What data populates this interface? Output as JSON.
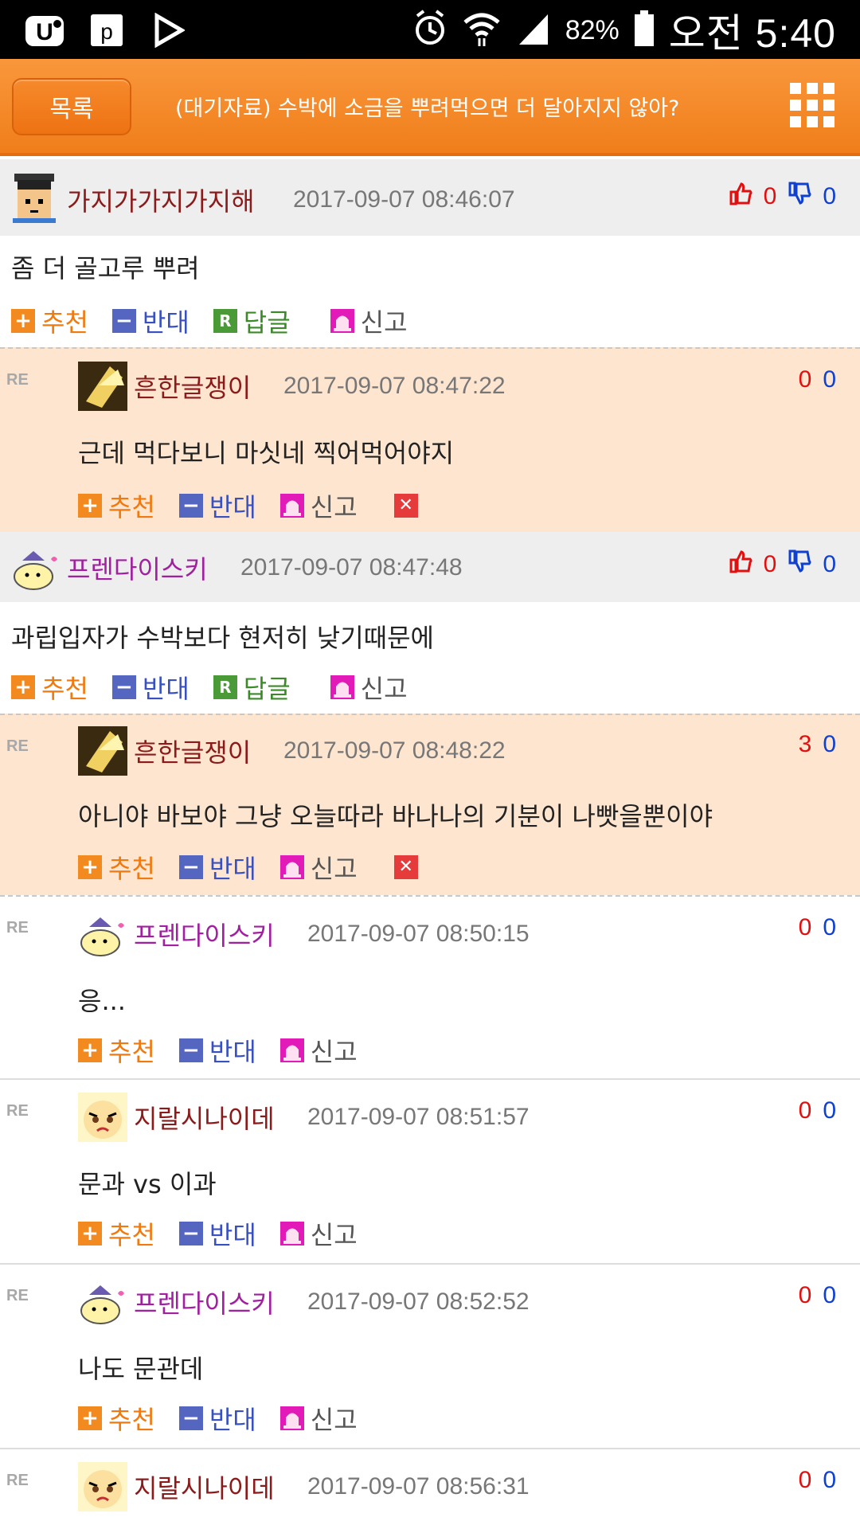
{
  "status_bar": {
    "battery": "82%",
    "time": "오전 5:40"
  },
  "header": {
    "list_button": "목록",
    "title": "(대기자료) 수박에 소금을 뿌려먹으면 더 달아지지 않아?"
  },
  "actions": {
    "recommend": "추천",
    "oppose": "반대",
    "reply": "답글",
    "report": "신고",
    "re_marker": "RE",
    "reply_box": "R"
  },
  "comments": [
    {
      "nick": "가지가가지가지해",
      "date": "2017-09-07 08:46:07",
      "text": "좀 더 골고루 뿌려",
      "up": "0",
      "down": "0",
      "nick_color": "#8b1a1a"
    },
    {
      "nick": "흔한글쟁이",
      "date": "2017-09-07 08:47:22",
      "text": "근데 먹다보니 마싯네 찍어먹어야지",
      "up": "0",
      "down": "0",
      "nick_color": "#8b1a1a"
    },
    {
      "nick": "프렌다이스키",
      "date": "2017-09-07 08:47:48",
      "text": "과립입자가 수박보다 현저히 낮기때문에",
      "up": "0",
      "down": "0",
      "nick_color": "#a020a0"
    },
    {
      "nick": "흔한글쟁이",
      "date": "2017-09-07 08:48:22",
      "text": "아니야 바보야 그냥 오늘따라 바나나의 기분이 나빳을뿐이야",
      "up": "3",
      "down": "0",
      "nick_color": "#8b1a1a"
    },
    {
      "nick": "프렌다이스키",
      "date": "2017-09-07 08:50:15",
      "text": "응...",
      "up": "0",
      "down": "0",
      "nick_color": "#a020a0"
    },
    {
      "nick": "지랄시나이데",
      "date": "2017-09-07 08:51:57",
      "text": "문과 vs 이과",
      "up": "0",
      "down": "0",
      "nick_color": "#8b1a1a"
    },
    {
      "nick": "프렌다이스키",
      "date": "2017-09-07 08:52:52",
      "text": "나도 문관데",
      "up": "0",
      "down": "0",
      "nick_color": "#a020a0"
    },
    {
      "nick": "지랄시나이데",
      "date": "2017-09-07 08:56:31",
      "text": "",
      "up": "0",
      "down": "0",
      "nick_color": "#8b1a1a"
    }
  ]
}
